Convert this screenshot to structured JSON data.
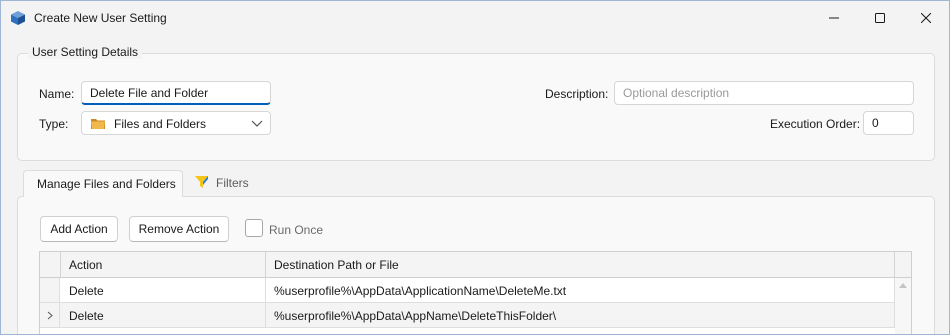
{
  "window": {
    "title": "Create New User Setting",
    "icon": "cube-app-icon",
    "controls": [
      "minimize-icon",
      "maximize-icon",
      "close-icon"
    ]
  },
  "details": {
    "group_label": "User Setting Details",
    "name_label": "Name:",
    "name_value": "Delete File and Folder",
    "type_label": "Type:",
    "type_value": "Files and Folders",
    "type_icon": "folder-icon",
    "description_label": "Description:",
    "description_value": "",
    "description_placeholder": "Optional description",
    "execution_order_label": "Execution Order:",
    "execution_order_value": "0"
  },
  "tabs": [
    {
      "label": "Manage Files and Folders",
      "active": true
    },
    {
      "label": "Filters",
      "active": false,
      "icon": "filter-icon"
    }
  ],
  "toolbar": {
    "add_label": "Add Action",
    "remove_label": "Remove Action",
    "run_once_label": "Run Once",
    "run_once_checked": false
  },
  "grid": {
    "columns": [
      "Action",
      "Destination Path or File"
    ],
    "rows": [
      {
        "action": "Delete",
        "path": "%userprofile%\\AppData\\ApplicationName\\DeleteMe.txt",
        "current": false
      },
      {
        "action": "Delete",
        "path": "%userprofile%\\AppData\\AppName\\DeleteThisFolder\\",
        "current": true
      }
    ]
  },
  "colors": {
    "accent": "#005fb8",
    "window_bg": "#f3f3f3",
    "folder_icon": "#e8a93b",
    "filter_icon_yellow": "#f5c518",
    "filter_icon_blue": "#2a7de1"
  }
}
